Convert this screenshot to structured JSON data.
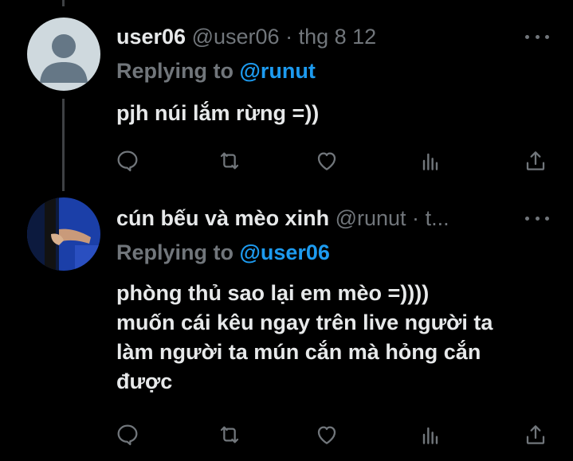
{
  "tweets": [
    {
      "display_name": "user06",
      "handle": "@user06",
      "separator": "·",
      "date": "thg 8 12",
      "replying_label": "Replying to",
      "replying_to": "@runut",
      "text": "pjh núi lắm rừng =))",
      "avatar": "default-avatar"
    },
    {
      "display_name": "cún bếu và mèo xinh",
      "handle": "@runut",
      "separator": "·",
      "date": "t...",
      "replying_label": "Replying to",
      "replying_to": "@user06",
      "text": "phòng thủ sao lại em mèo =))))\nmuốn cái kêu ngay trên live người ta\nlàm người ta mún cắn mà hỏng cắn\nđược",
      "avatar": "photo-avatar"
    }
  ],
  "actions": [
    "reply-icon",
    "retweet-icon",
    "like-icon",
    "views-icon",
    "share-icon"
  ],
  "colors": {
    "background": "#000000",
    "text": "#e7e9ea",
    "muted": "#71767b",
    "link": "#1d9bf0",
    "thread_line": "#3e4144"
  }
}
